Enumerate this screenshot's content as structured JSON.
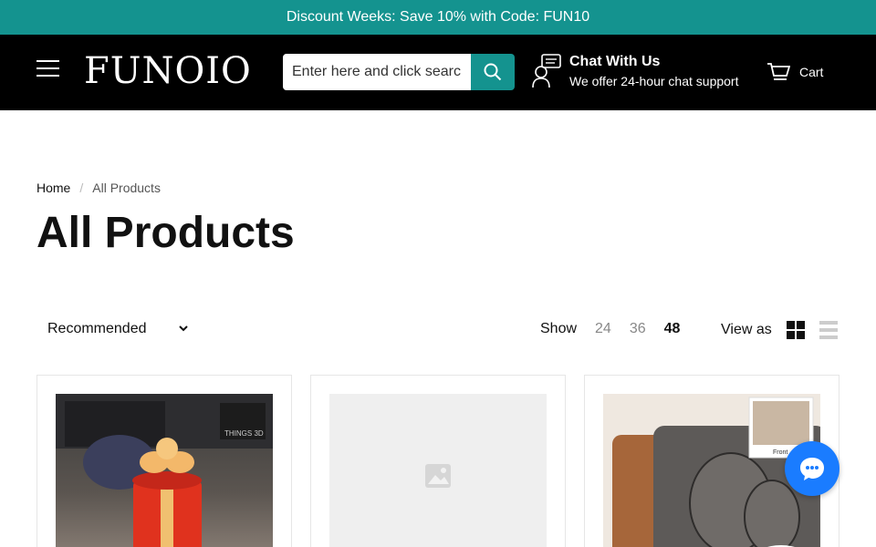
{
  "announcement": {
    "text": "Discount Weeks: Save 10% with Code: FUN10"
  },
  "header": {
    "logo": "FUNOIO",
    "search": {
      "placeholder": "Enter here and click search",
      "value": ""
    },
    "chat": {
      "title": "Chat With Us",
      "subtitle": "We offer 24-hour chat support"
    },
    "cart_label": "Cart"
  },
  "breadcrumb": {
    "home": "Home",
    "separator": "/",
    "current": "All Products"
  },
  "page_title": "All Products",
  "toolbar": {
    "sort_value": "Recommended",
    "show_label": "Show",
    "show_options": [
      "24",
      "36",
      "48"
    ],
    "show_active": "48",
    "view_label": "View as"
  },
  "products": [
    {
      "image": "gift-box-photo",
      "watermark": "THINGS 3D"
    },
    {
      "image": "placeholder-image"
    },
    {
      "image": "engraved-photo-wallet",
      "photo_caption": "Front"
    }
  ],
  "colors": {
    "accent": "#14938f",
    "header_bg": "#000000",
    "chat_bubble": "#1a7cff"
  }
}
